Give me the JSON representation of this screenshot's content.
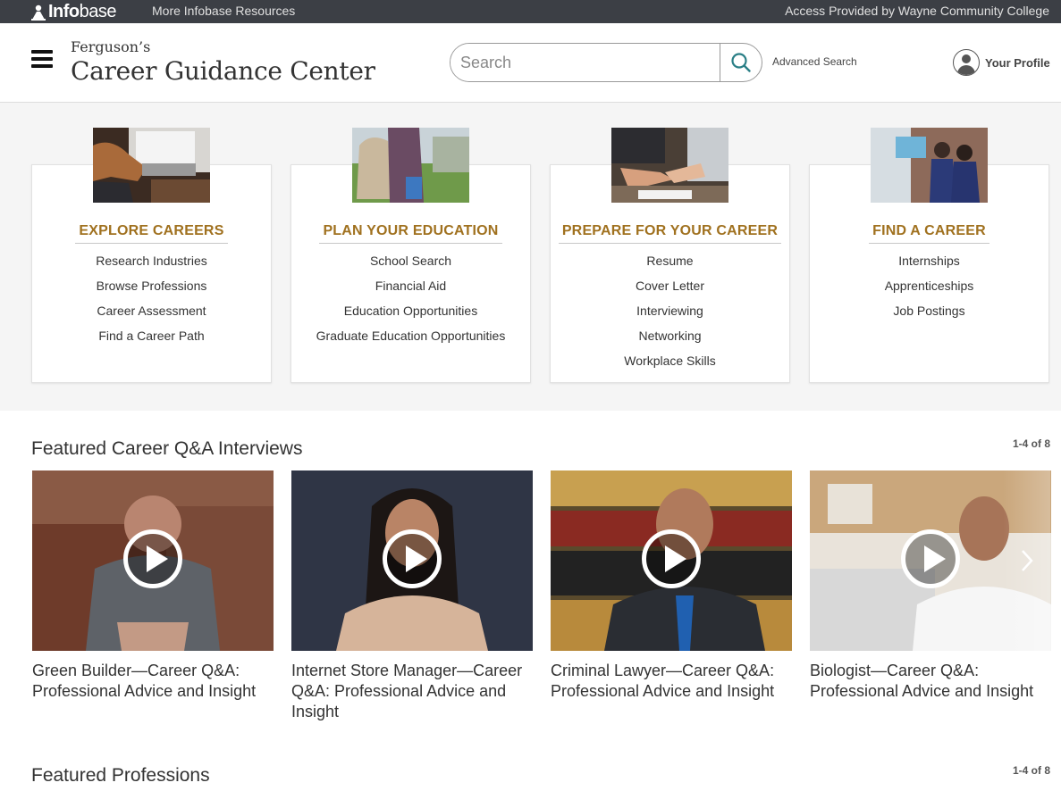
{
  "topbar": {
    "logo_text_a": "Info",
    "logo_text_b": "base",
    "more_resources": "More Infobase Resources",
    "access": "Access Provided by Wayne Community College"
  },
  "header": {
    "brand_small": "Ferguson’s",
    "brand_title": "Career Guidance Center",
    "search_placeholder": "Search",
    "advanced_search": "Advanced Search",
    "profile_label": "Your Profile"
  },
  "categories": [
    {
      "title": "EXPLORE CAREERS",
      "image": "laptop-typing-photo",
      "links": [
        "Research Industries",
        "Browse Professions",
        "Career Assessment",
        "Find a Career Path"
      ]
    },
    {
      "title": "PLAN YOUR EDUCATION",
      "image": "student-backpack-photo",
      "links": [
        "School Search",
        "Financial Aid",
        "Education Opportunities",
        "Graduate Education Opportunities"
      ]
    },
    {
      "title": "PREPARE FOR YOUR CAREER",
      "image": "handshake-photo",
      "links": [
        "Resume",
        "Cover Letter",
        "Interviewing",
        "Networking",
        "Workplace Skills"
      ]
    },
    {
      "title": "FIND A CAREER",
      "image": "lab-workers-photo",
      "links": [
        "Internships",
        "Apprenticeships",
        "Job Postings"
      ]
    }
  ],
  "featured_interviews": {
    "title": "Featured Career Q&A Interviews",
    "count": "1-4 of 8",
    "videos": [
      {
        "title": "Green Builder—Career Q&A: Professional Advice and Insight"
      },
      {
        "title": "Internet Store Manager—Career Q&A: Professional Advice and Insight"
      },
      {
        "title": "Criminal Lawyer—Career Q&A: Professional Advice and Insight"
      },
      {
        "title": "Biologist—Career Q&A: Professional Advice and Insight"
      }
    ]
  },
  "featured_professions": {
    "title": "Featured Professions",
    "count": "1-4 of 8"
  },
  "colors": {
    "topbar": "#3c3f45",
    "category_heading": "#a0711f",
    "search_icon": "#2a7f86"
  }
}
